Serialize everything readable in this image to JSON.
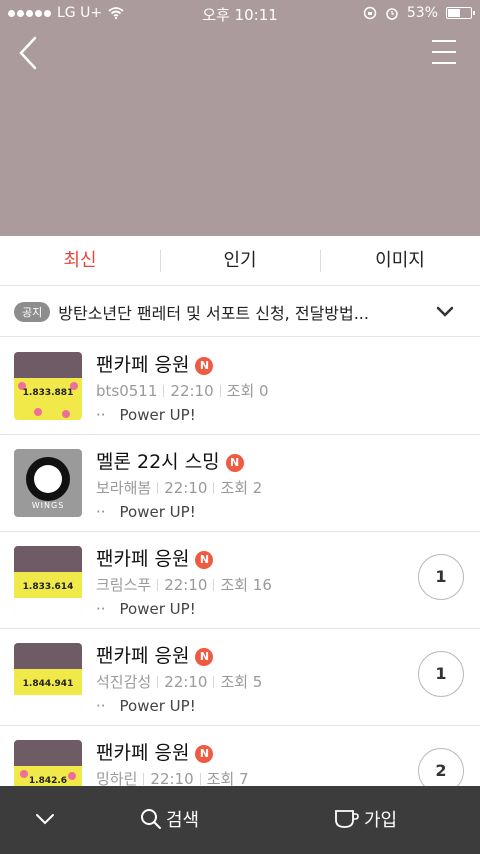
{
  "status_bar": {
    "carrier": "LG U+",
    "time": "오후 10:11",
    "battery": "53%",
    "battery_level": 0.53
  },
  "header": {
    "background_color": "#ab9b9c",
    "back_icon": "chevron-left-icon",
    "menu_icon": "hamburger-icon"
  },
  "tabs": [
    {
      "label": "최신",
      "active": true
    },
    {
      "label": "인기",
      "active": false
    },
    {
      "label": "이미지",
      "active": false
    }
  ],
  "notice": {
    "badge": "공지",
    "text": "방탄소년단 팬레터 및 서포트 신청, 전달방법..."
  },
  "posts": [
    {
      "title": "팬카페 응원",
      "new_badge": "N",
      "author": "bts0511",
      "time": "22:10",
      "views": "조회 0",
      "snippet": "Power UP!",
      "thumb_num": "1.833.881",
      "comments": null
    },
    {
      "title": "멜론 22시 스밍",
      "new_badge": "N",
      "author": "보라해봄",
      "time": "22:10",
      "views": "조회 2",
      "snippet": "Power UP!",
      "thumb_text": "WINGS",
      "comments": null
    },
    {
      "title": "팬카페 응원",
      "new_badge": "N",
      "author": "크림스푸",
      "time": "22:10",
      "views": "조회 16",
      "snippet": "Power UP!",
      "thumb_num": "1.833.614",
      "comments": "1"
    },
    {
      "title": "팬카페 응원",
      "new_badge": "N",
      "author": "석진감성",
      "time": "22:10",
      "views": "조회 5",
      "snippet": "Power UP!",
      "thumb_num": "1.844.941",
      "comments": "1"
    },
    {
      "title": "팬카페 응원",
      "new_badge": "N",
      "author": "밍하린",
      "time": "22:10",
      "views": "조회 7",
      "snippet": "",
      "thumb_num": "1.842.6",
      "comments": "2"
    }
  ],
  "snippet_prefix": "··",
  "bottom_bar": {
    "search_label": "검색",
    "join_label": "가입"
  },
  "accent_color": "#e6473a"
}
